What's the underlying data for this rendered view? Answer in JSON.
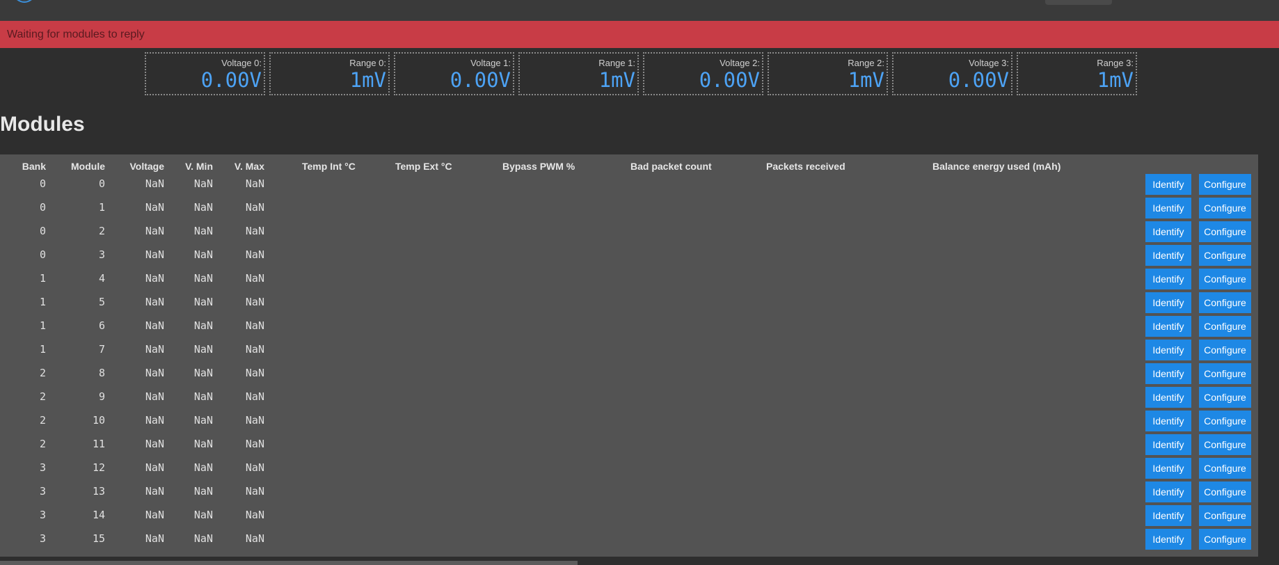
{
  "alert": {
    "text": "Waiting for modules to reply",
    "color": "#c83c46"
  },
  "stats": [
    {
      "label": "Voltage 0:",
      "value": "0.00V"
    },
    {
      "label": "Range 0:",
      "value": "1mV"
    },
    {
      "label": "Voltage 1:",
      "value": "0.00V"
    },
    {
      "label": "Range 1:",
      "value": "1mV"
    },
    {
      "label": "Voltage 2:",
      "value": "0.00V"
    },
    {
      "label": "Range 2:",
      "value": "1mV"
    },
    {
      "label": "Voltage 3:",
      "value": "0.00V"
    },
    {
      "label": "Range 3:",
      "value": "1mV"
    }
  ],
  "modules": {
    "title": "Modules",
    "columns": [
      "Bank",
      "Module",
      "Voltage",
      "V. Min",
      "V. Max",
      "Temp Int °C",
      "Temp Ext °C",
      "Bypass PWM %",
      "Bad packet count",
      "Packets received",
      "Balance energy used (mAh)"
    ],
    "identify_label": "Identify",
    "configure_label": "Configure",
    "rows": [
      {
        "bank": "0",
        "module": "0",
        "voltage": "NaN",
        "vmin": "NaN",
        "vmax": "NaN"
      },
      {
        "bank": "0",
        "module": "1",
        "voltage": "NaN",
        "vmin": "NaN",
        "vmax": "NaN"
      },
      {
        "bank": "0",
        "module": "2",
        "voltage": "NaN",
        "vmin": "NaN",
        "vmax": "NaN"
      },
      {
        "bank": "0",
        "module": "3",
        "voltage": "NaN",
        "vmin": "NaN",
        "vmax": "NaN"
      },
      {
        "bank": "1",
        "module": "4",
        "voltage": "NaN",
        "vmin": "NaN",
        "vmax": "NaN"
      },
      {
        "bank": "1",
        "module": "5",
        "voltage": "NaN",
        "vmin": "NaN",
        "vmax": "NaN"
      },
      {
        "bank": "1",
        "module": "6",
        "voltage": "NaN",
        "vmin": "NaN",
        "vmax": "NaN"
      },
      {
        "bank": "1",
        "module": "7",
        "voltage": "NaN",
        "vmin": "NaN",
        "vmax": "NaN"
      },
      {
        "bank": "2",
        "module": "8",
        "voltage": "NaN",
        "vmin": "NaN",
        "vmax": "NaN"
      },
      {
        "bank": "2",
        "module": "9",
        "voltage": "NaN",
        "vmin": "NaN",
        "vmax": "NaN"
      },
      {
        "bank": "2",
        "module": "10",
        "voltage": "NaN",
        "vmin": "NaN",
        "vmax": "NaN"
      },
      {
        "bank": "2",
        "module": "11",
        "voltage": "NaN",
        "vmin": "NaN",
        "vmax": "NaN"
      },
      {
        "bank": "3",
        "module": "12",
        "voltage": "NaN",
        "vmin": "NaN",
        "vmax": "NaN"
      },
      {
        "bank": "3",
        "module": "13",
        "voltage": "NaN",
        "vmin": "NaN",
        "vmax": "NaN"
      },
      {
        "bank": "3",
        "module": "14",
        "voltage": "NaN",
        "vmin": "NaN",
        "vmax": "NaN"
      },
      {
        "bank": "3",
        "module": "15",
        "voltage": "NaN",
        "vmin": "NaN",
        "vmax": "NaN"
      }
    ]
  },
  "colors": {
    "accent": "#1e88e5",
    "value_text": "#4da3f5",
    "panel": "#535353",
    "background": "#2e2e2e"
  }
}
